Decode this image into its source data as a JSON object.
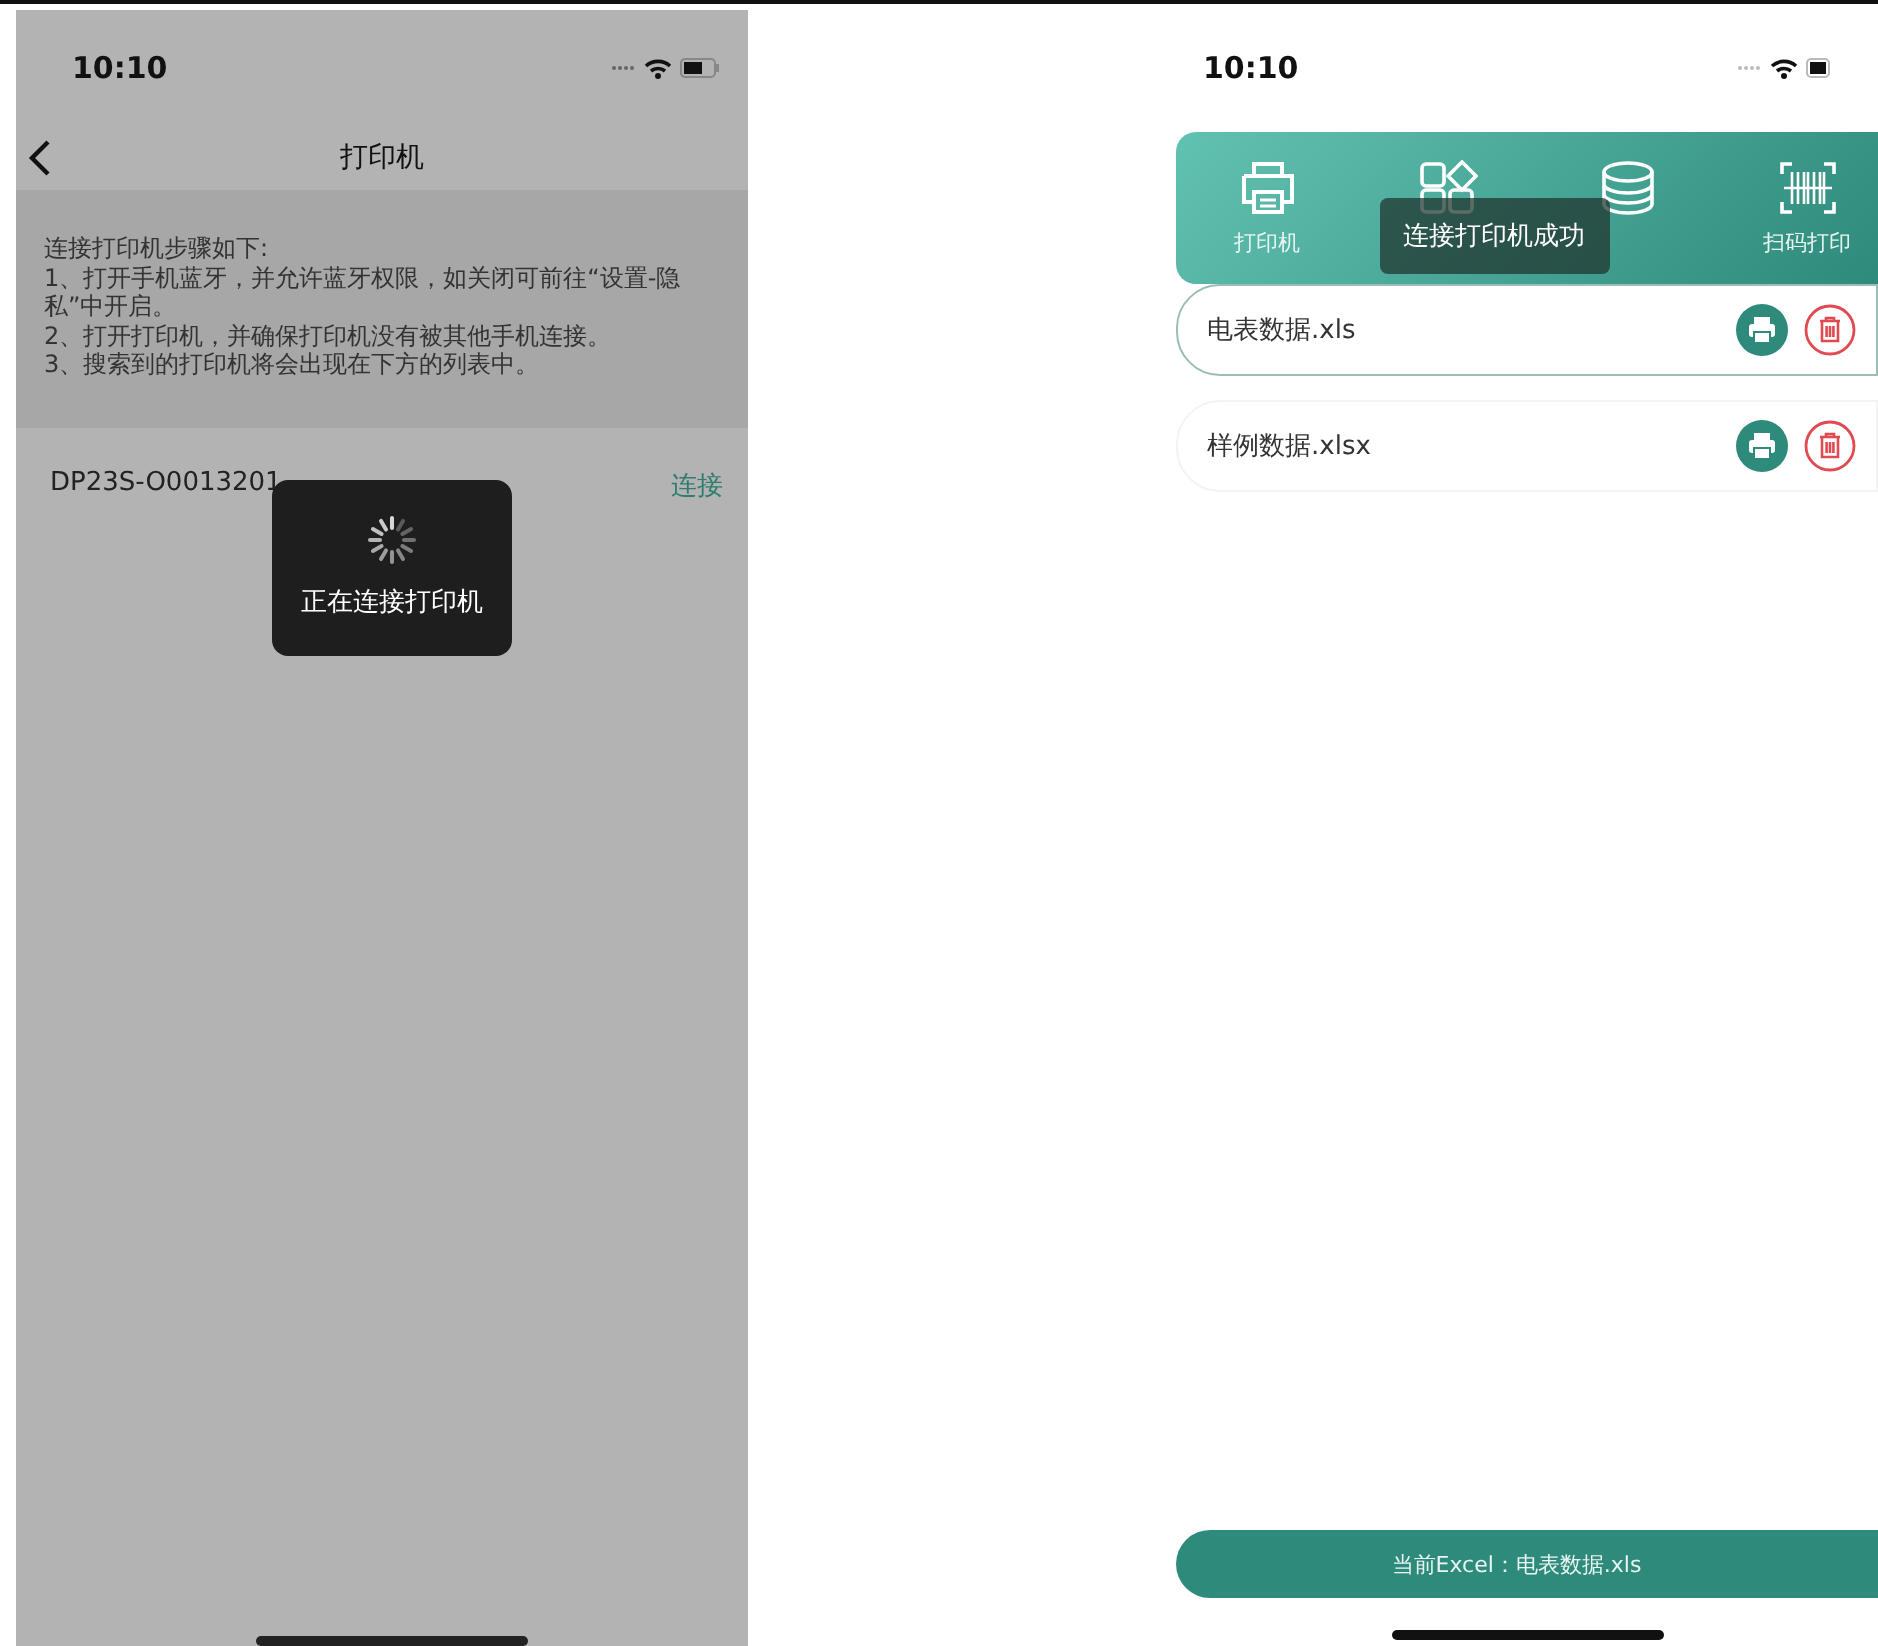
{
  "printer_screen": {
    "status_bar": {
      "time": "10:10"
    },
    "nav_bar": {
      "title": "打印机"
    },
    "instructions": [
      "连接打印机步骤如下:",
      "1、打开手机蓝牙，并允许蓝牙权限，如关闭可前往“设置-隐私”中开启。",
      "2、打开打印机，并确保打印机没有被其他手机连接。",
      "3、搜索到的打印机将会出现在下方的列表中。"
    ],
    "devices": [
      {
        "name": "DP23S-O0013201",
        "action": "连接"
      }
    ],
    "loading_toast": {
      "message": "正在连接打印机"
    }
  },
  "home_screen": {
    "status_bar": {
      "time": "10:10"
    },
    "toolbar": [
      {
        "kind": "printer",
        "label": "打印机"
      },
      {
        "kind": "shapes"
      },
      {
        "kind": "database"
      },
      {
        "kind": "barcode",
        "label": "扫码打印"
      }
    ],
    "toast": {
      "message": "连接打印机成功"
    },
    "files": [
      {
        "name": "电表数据.xls",
        "selected": true
      },
      {
        "name": "样例数据.xlsx",
        "selected": false
      }
    ],
    "current_file_bar": {
      "text": "当前Excel：电表数据.xls"
    }
  }
}
